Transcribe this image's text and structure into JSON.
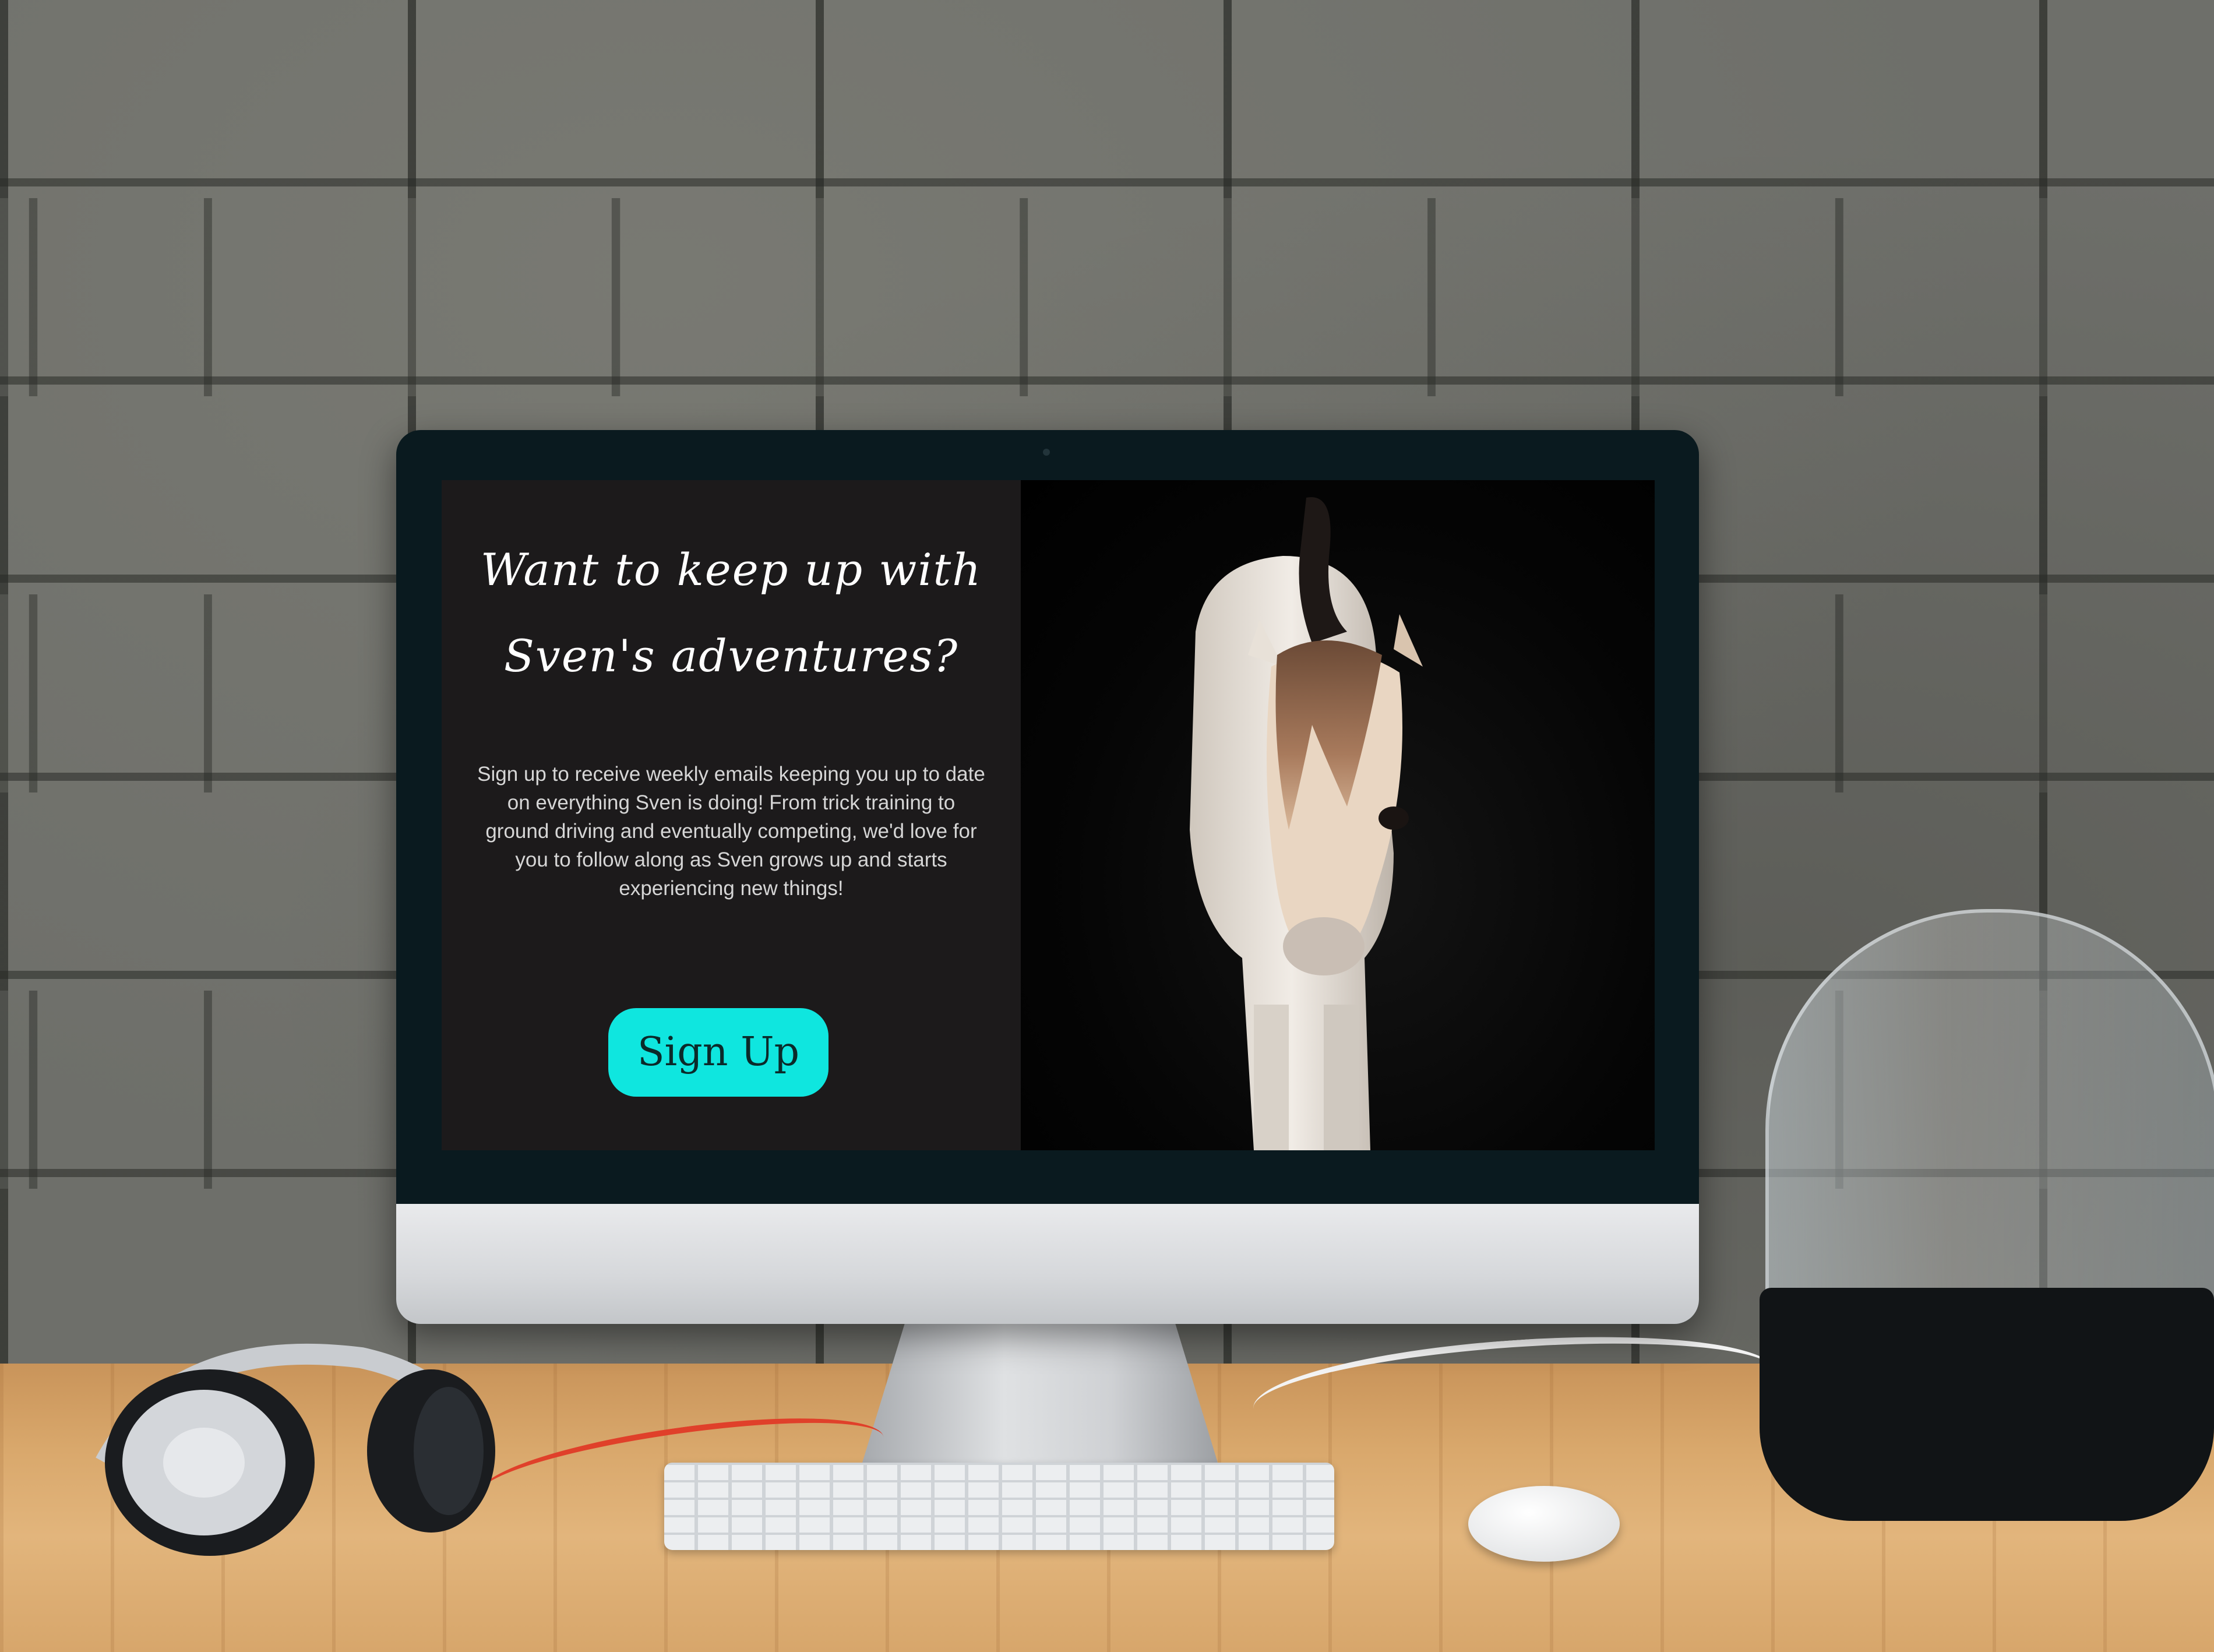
{
  "landing": {
    "headline_line1": "Want to keep up with",
    "headline_line2": "Sven's adventures?",
    "body": "Sign up to receive weekly emails keeping you up to date on everything Sven is doing! From trick training to ground driving and eventually competing, we'd love for you to follow along as Sven grows up and starts experiencing new things!",
    "signup_label": "Sign Up"
  },
  "colors": {
    "left_panel_bg": "#1c1a1b",
    "button_bg": "#0fe6df",
    "headline_text": "#ffffff",
    "body_text": "#d6d6d6"
  },
  "icons": [
    "horse-photo",
    "headphones-icon",
    "keyboard",
    "mouse",
    "speaker"
  ]
}
